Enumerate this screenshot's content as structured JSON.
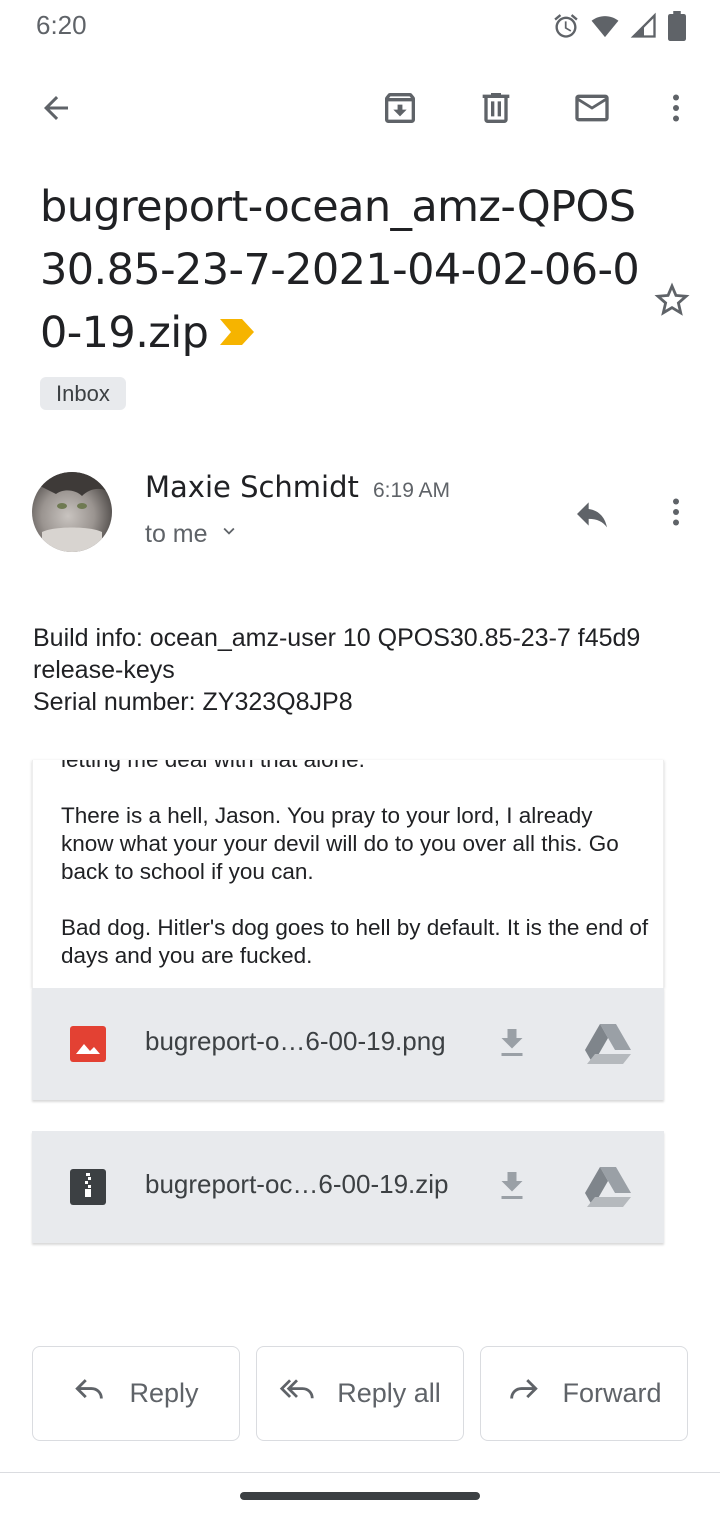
{
  "status_bar": {
    "time": "6:20",
    "icons": [
      "alarm-icon",
      "wifi-icon",
      "signal-icon",
      "battery-icon"
    ]
  },
  "toolbar": {
    "icons": [
      "back-arrow-icon",
      "archive-icon",
      "delete-icon",
      "mark-unread-icon",
      "more-vert-icon"
    ]
  },
  "email": {
    "subject": "bugreport-ocean_amz-QPOS30.85-23-7-2021-04-02-06-00-19.zip",
    "label": "Inbox",
    "sender": {
      "name": "Maxie Schmidt",
      "time": "6:19 AM",
      "recipient": "to me"
    },
    "body": {
      "build_info": "Build info: ocean_amz-user 10 QPOS30.85-23-7 f45d9 release-keys",
      "serial": "Serial number: ZY323Q8JP8"
    },
    "quoted": {
      "line_cut": "letting me deal with that alone.",
      "para1": "There is a hell, Jason. You pray to your lord, I already know what your your devil will do to you over all this. Go back to school if you can.",
      "para2": "Bad dog. Hitler's dog goes to hell by default. It is the end of days and you are fucked."
    },
    "attachments": [
      {
        "name": "bugreport-o…6-00-19.png",
        "type": "image-file-icon",
        "type_color": "#e34133"
      },
      {
        "name": "bugreport-oc…6-00-19.zip",
        "type": "zip-file-icon",
        "type_color": "#3c4043"
      }
    ]
  },
  "actions": {
    "reply": "Reply",
    "reply_all": "Reply all",
    "forward": "Forward"
  },
  "colors": {
    "importance": "#f6b400",
    "icon_gray": "#5f6368",
    "chip_bg": "#e8eaed"
  }
}
